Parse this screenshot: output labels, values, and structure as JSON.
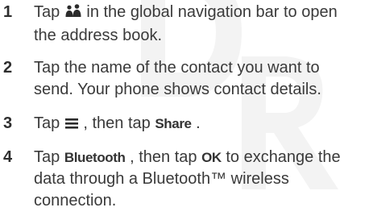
{
  "watermark_text": "DRAFT",
  "steps": [
    {
      "number": "1",
      "line1_before": "Tap ",
      "line1_icon": "contacts-icon",
      "line1_after": " in the global navigation bar to open",
      "line2": "the address book."
    },
    {
      "number": "2",
      "line1": "Tap the name of the contact you want to",
      "line2": "send. Your phone shows contact details."
    },
    {
      "number": "3",
      "before": "Tap ",
      "icon": "menu-icon",
      "middle": ", then tap ",
      "keyword": "Share",
      "after": "."
    },
    {
      "number": "4",
      "line1_before": "Tap ",
      "keyword1": "Bluetooth",
      "line1_mid": ", then tap ",
      "keyword2": "OK",
      "line1_after": " to exchange the",
      "line2": "data through a Bluetooth™ wireless",
      "line3": "connection."
    }
  ]
}
